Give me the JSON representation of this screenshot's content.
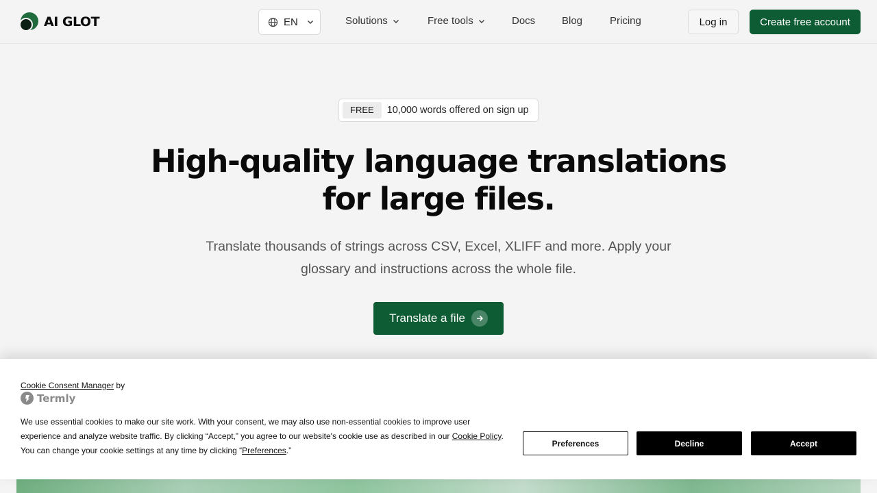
{
  "header": {
    "logo_text": "AI GLOT",
    "language": "EN",
    "nav": {
      "solutions": "Solutions",
      "free_tools": "Free tools",
      "docs": "Docs",
      "blog": "Blog",
      "pricing": "Pricing"
    },
    "login": "Log in",
    "create_account": "Create free account"
  },
  "hero": {
    "promo_badge": "FREE",
    "promo_text": "10,000 words offered on sign up",
    "title_line1": "High-quality language translations",
    "title_line2": "for large files.",
    "subtitle": "Translate thousands of strings across CSV, Excel, XLIFF and more. Apply your glossary and instructions across the whole file.",
    "cta": "Translate a file"
  },
  "cookie_banner": {
    "manager_link": "Cookie Consent Manager",
    "by": "by",
    "brand": "Termly",
    "text_part1": "We use essential cookies to make our site work. With your consent, we may also use non-essential cookies to improve user experience and analyze website traffic. By clicking “Accept,” you agree to our website's cookie use as described in our ",
    "policy_link": "Cookie Policy",
    "text_part2": ". You can change your cookie settings at any time by clicking “",
    "preferences_link": "Preferences",
    "text_part3": ".”",
    "preferences_button": "Preferences",
    "decline_button": "Decline",
    "accept_button": "Accept"
  },
  "colors": {
    "brand_green": "#0d5c33",
    "background": "#f4f4f4"
  }
}
